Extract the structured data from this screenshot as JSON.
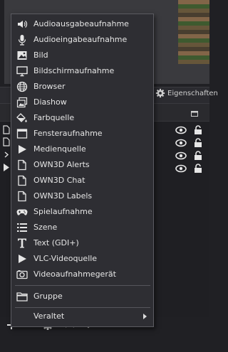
{
  "background": {
    "properties_label": "Eigenschaften"
  },
  "menu": {
    "items": [
      {
        "label": "Audioausgabeaufnahme",
        "icon": "speaker-icon"
      },
      {
        "label": "Audioeingabeaufnahme",
        "icon": "microphone-icon"
      },
      {
        "label": "Bild",
        "icon": "image-icon"
      },
      {
        "label": "Bildschirmaufnahme",
        "icon": "monitor-icon"
      },
      {
        "label": "Browser",
        "icon": "globe-icon"
      },
      {
        "label": "Diashow",
        "icon": "slideshow-icon"
      },
      {
        "label": "Farbquelle",
        "icon": "paint-bucket-icon"
      },
      {
        "label": "Fensteraufnahme",
        "icon": "window-icon"
      },
      {
        "label": "Medienquelle",
        "icon": "play-icon"
      },
      {
        "label": "OWN3D Alerts",
        "icon": "document-icon"
      },
      {
        "label": "OWN3D Chat",
        "icon": "document-icon"
      },
      {
        "label": "OWN3D Labels",
        "icon": "document-icon"
      },
      {
        "label": "Spielaufnahme",
        "icon": "gamepad-icon"
      },
      {
        "label": "Szene",
        "icon": "list-icon"
      },
      {
        "label": "Text (GDI+)",
        "icon": "text-icon"
      },
      {
        "label": "VLC-Videoquelle",
        "icon": "play-icon"
      },
      {
        "label": "Videoaufnahmegerät",
        "icon": "camera-icon"
      }
    ],
    "group": {
      "label": "Gruppe",
      "icon": "folder-icon"
    },
    "deprecated": {
      "label": "Veraltet"
    }
  }
}
